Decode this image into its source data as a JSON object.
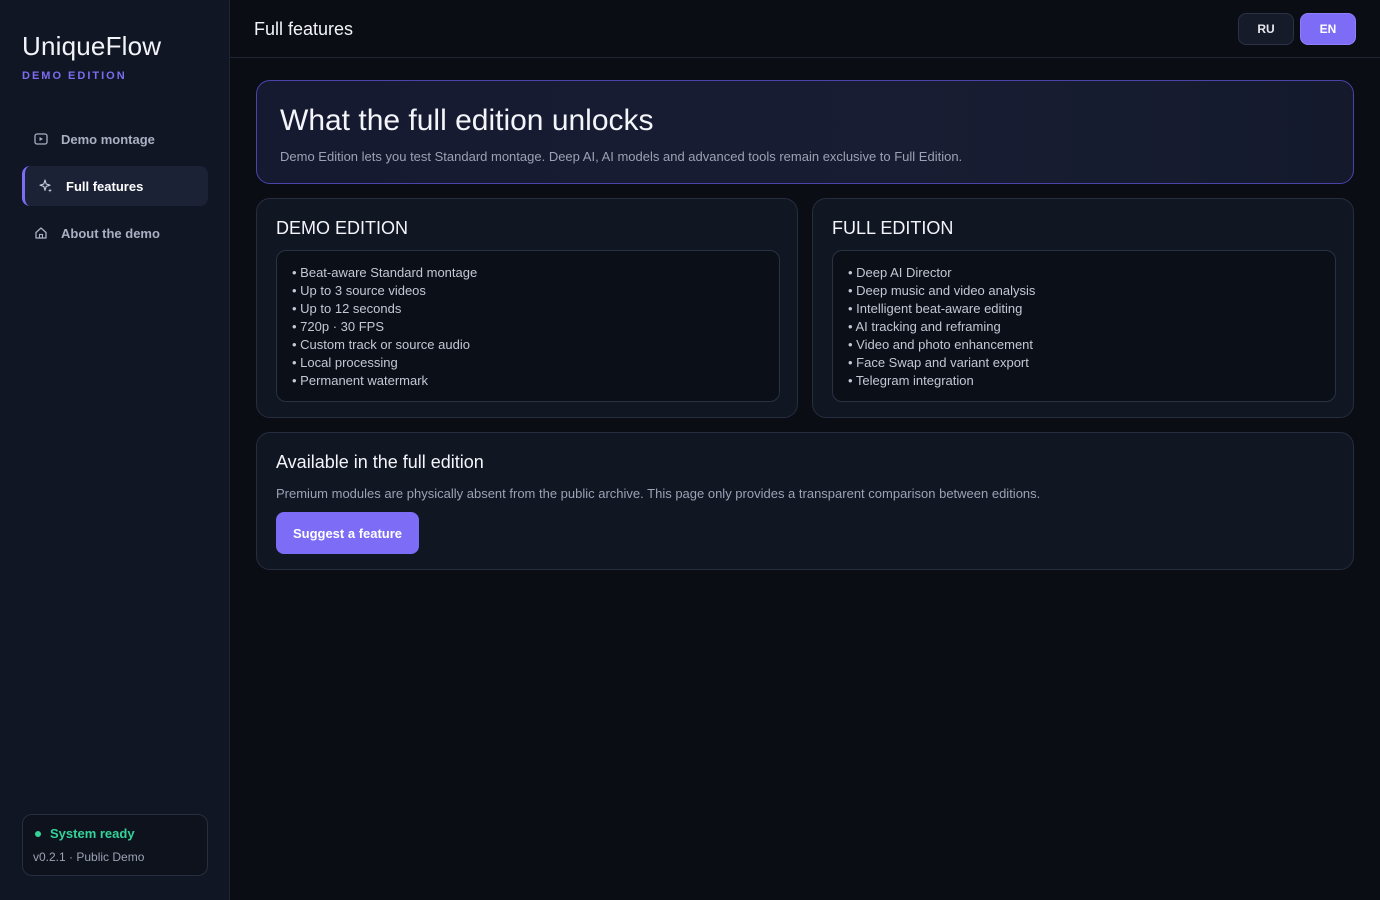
{
  "app": {
    "name": "UniqueFlow",
    "edition_tag": "DEMO EDITION"
  },
  "sidebar": {
    "items": [
      {
        "label": "Demo montage",
        "icon": "play-icon",
        "active": false
      },
      {
        "label": "Full features",
        "icon": "sparkles-icon",
        "active": true
      },
      {
        "label": "About the demo",
        "icon": "home-icon",
        "active": false
      }
    ],
    "status": {
      "text": "System ready",
      "version": "v0.2.1 · Public Demo",
      "color": "#34d399"
    }
  },
  "header": {
    "title": "Full features",
    "languages": [
      {
        "label": "RU",
        "selected": false
      },
      {
        "label": "EN",
        "selected": true
      }
    ]
  },
  "hero": {
    "title": "What the full edition unlocks",
    "subtitle": "Demo Edition lets you test Standard montage. Deep AI, AI models and advanced tools remain exclusive to Full Edition."
  },
  "editions": {
    "demo": {
      "title": "DEMO EDITION",
      "features": [
        "• Beat-aware Standard montage",
        "• Up to 3 source videos",
        "• Up to 12 seconds",
        "• 720p · 30 FPS",
        "• Custom track or source audio",
        "• Local processing",
        "• Permanent watermark"
      ]
    },
    "full": {
      "title": "FULL EDITION",
      "features": [
        "• Deep AI Director",
        "• Deep music and video analysis",
        "• Intelligent beat-aware editing",
        "• AI tracking and reframing",
        "• Video and photo enhancement",
        "• Face Swap and variant export",
        "• Telegram integration"
      ]
    }
  },
  "available": {
    "title": "Available in the full edition",
    "description": "Premium modules are physically absent from the public archive. This page only provides a transparent comparison between editions.",
    "button_label": "Suggest a feature"
  },
  "colors": {
    "accent": "#7c6cf6",
    "background": "#0a0d14",
    "success": "#34d399"
  }
}
